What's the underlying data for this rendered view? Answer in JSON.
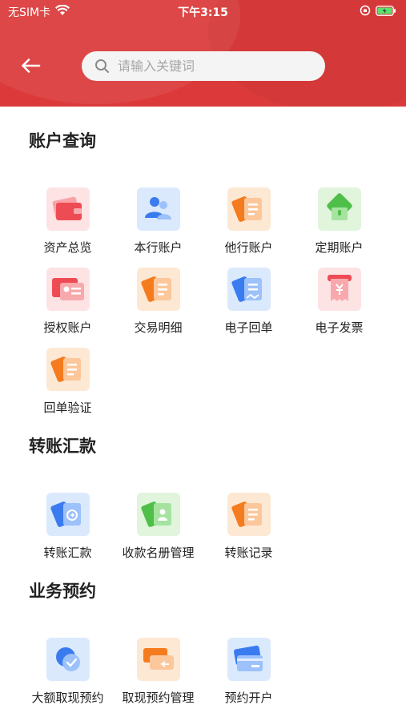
{
  "status_bar": {
    "carrier": "无SIM卡",
    "time": "下午3:15"
  },
  "search": {
    "placeholder": "请输入关键词"
  },
  "colors": {
    "header": "#dc3a3a",
    "red": "#e8484f",
    "blue": "#3a7bf0",
    "orange": "#f47b1e",
    "green": "#4fbf4a"
  },
  "sections": [
    {
      "title": "账户查询",
      "items": [
        {
          "label": "资产总览",
          "icon": "asset-overview-icon"
        },
        {
          "label": "本行账户",
          "icon": "bank-account-icon"
        },
        {
          "label": "他行账户",
          "icon": "other-bank-account-icon"
        },
        {
          "label": "定期账户",
          "icon": "fixed-deposit-icon"
        },
        {
          "label": "授权账户",
          "icon": "authorized-account-icon"
        },
        {
          "label": "交易明细",
          "icon": "transaction-detail-icon"
        },
        {
          "label": "电子回单",
          "icon": "e-receipt-icon"
        },
        {
          "label": "电子发票",
          "icon": "e-invoice-icon"
        },
        {
          "label": "回单验证",
          "icon": "receipt-verify-icon"
        }
      ]
    },
    {
      "title": "转账汇款",
      "items": [
        {
          "label": "转账汇款",
          "icon": "transfer-icon"
        },
        {
          "label": "收款名册管理",
          "icon": "payee-list-icon"
        },
        {
          "label": "转账记录",
          "icon": "transfer-record-icon"
        }
      ]
    },
    {
      "title": "业务预约",
      "items": [
        {
          "label": "大额取现预约",
          "icon": "large-withdrawal-icon"
        },
        {
          "label": "取现预约管理",
          "icon": "withdrawal-manage-icon"
        },
        {
          "label": "预约开户",
          "icon": "open-account-icon"
        }
      ]
    }
  ]
}
